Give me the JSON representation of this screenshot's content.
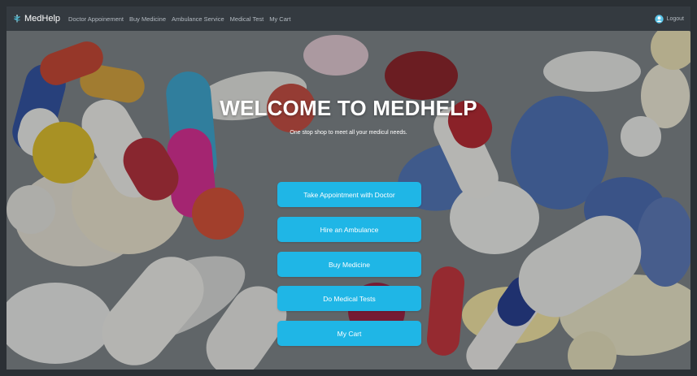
{
  "navbar": {
    "brand": "MedHelp",
    "brand_icon": "caduceus-icon",
    "links": [
      {
        "label": "Doctor Appoinement"
      },
      {
        "label": "Buy Medicine"
      },
      {
        "label": "Ambulance Service"
      },
      {
        "label": "Medical Test"
      },
      {
        "label": "My Cart"
      }
    ],
    "logout_label": "Logout",
    "logout_icon": "user-circle-icon"
  },
  "hero": {
    "title": "WELCOME TO MEDHELP",
    "subtitle": "One stop shop to meet all your medicul needs.",
    "buttons": [
      {
        "label": "Take Appointment with Doctor"
      },
      {
        "label": "Hire an Ambulance"
      },
      {
        "label": "Buy Medicine"
      },
      {
        "label": "Do Medical Tests"
      },
      {
        "label": "My Cart"
      }
    ],
    "background": "pills-photo"
  },
  "colors": {
    "navbar_bg": "#343a40",
    "button_bg": "#1fb6e6",
    "nav_text": "#b3bac1"
  }
}
